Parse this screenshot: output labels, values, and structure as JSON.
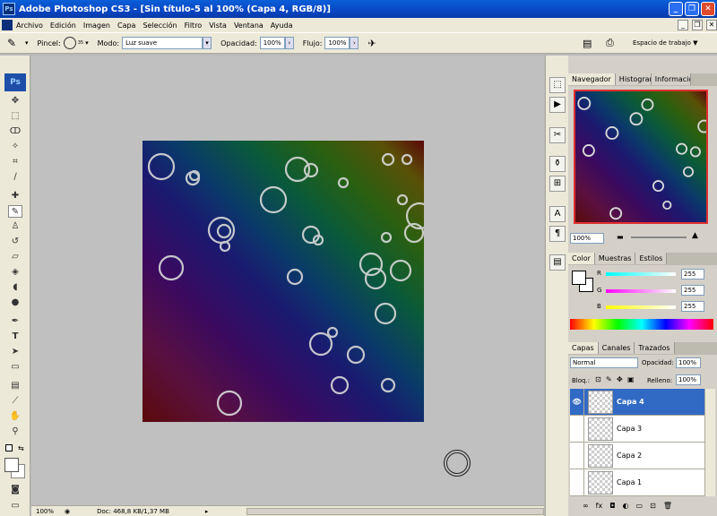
{
  "window": {
    "title": "Adobe Photoshop CS3 - [Sin título-5 al 100% (Capa 4, RGB/8)]",
    "app_icon": "Ps"
  },
  "menu": {
    "items": [
      "Archivo",
      "Edición",
      "Imagen",
      "Capa",
      "Selección",
      "Filtro",
      "Vista",
      "Ventana",
      "Ayuda"
    ]
  },
  "options": {
    "brush_label": "Pincel:",
    "brush_size": "35",
    "mode_label": "Modo:",
    "mode_value": "Luz suave",
    "opacity_label": "Opacidad:",
    "opacity_value": "100%",
    "flow_label": "Flujo:",
    "flow_value": "100%",
    "workspace_label": "Espacio de trabajo ▼"
  },
  "toolbox": {
    "logo": "Ps"
  },
  "status": {
    "zoom": "100%",
    "doc_info": "Doc: 468,8 KB/1,37 MB"
  },
  "navigator": {
    "tabs": [
      "Navegador",
      "Histograma",
      "Información"
    ],
    "zoom": "100%"
  },
  "color_panel": {
    "tabs": [
      "Color",
      "Muestras",
      "Estilos"
    ],
    "channels": [
      {
        "label": "R",
        "value": "255",
        "color": "#00ffff"
      },
      {
        "label": "G",
        "value": "255",
        "color": "#ff00ff"
      },
      {
        "label": "B",
        "value": "255",
        "color": "#ffff00"
      }
    ]
  },
  "layers_panel": {
    "tabs": [
      "Capas",
      "Canales",
      "Trazados"
    ],
    "blend_mode": "Normal",
    "opacity_label": "Opacidad:",
    "opacity_value": "100%",
    "lock_label": "Bloq.:",
    "fill_label": "Relleno:",
    "fill_value": "100%",
    "layers": [
      {
        "name": "Capa 4",
        "visible": true,
        "selected": true
      },
      {
        "name": "Capa 3",
        "visible": false,
        "selected": false
      },
      {
        "name": "Capa 2",
        "visible": false,
        "selected": false
      },
      {
        "name": "Capa 1",
        "visible": false,
        "selected": false
      }
    ]
  },
  "colors": {
    "accent": "#316ac5",
    "titlebar": "#0a46c4",
    "chrome": "#ece9d8"
  }
}
